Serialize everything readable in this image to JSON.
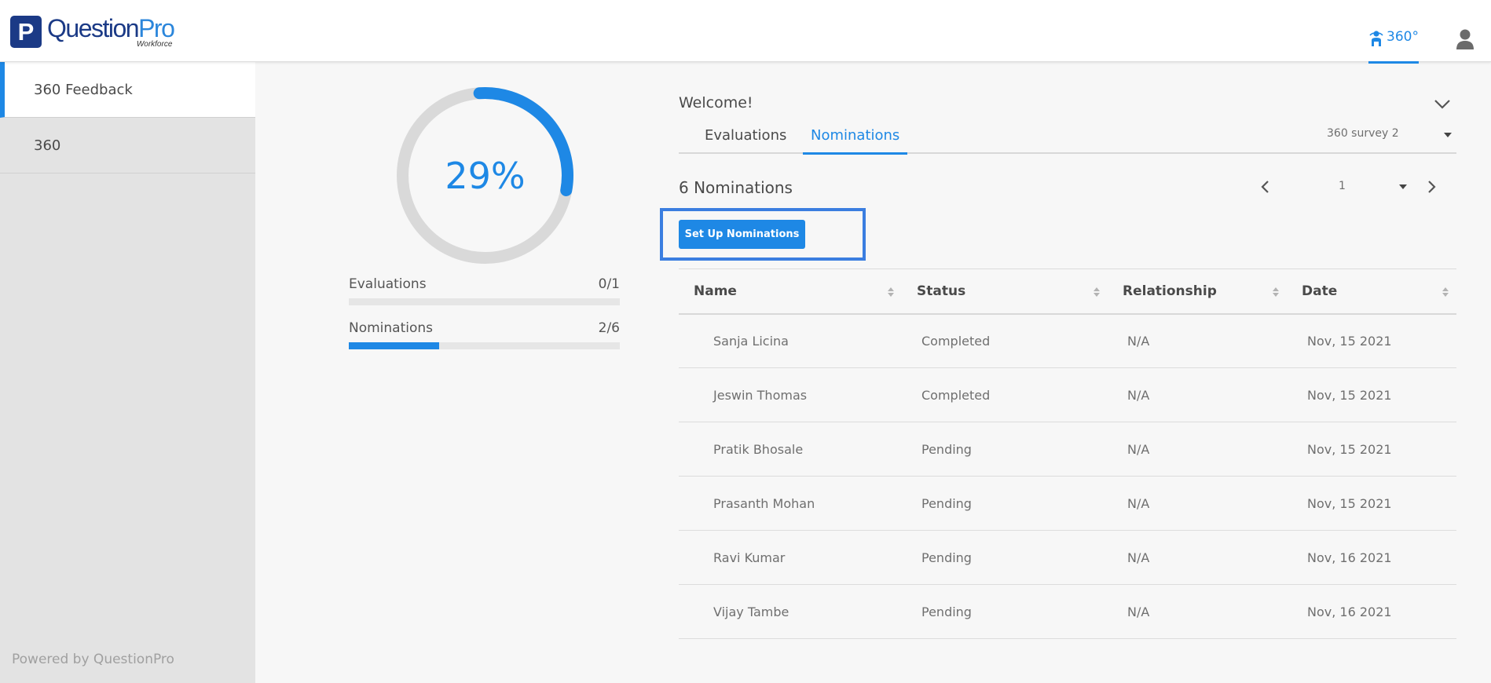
{
  "header": {
    "logo_mark": "P",
    "brand_question": "Question",
    "brand_pro": "Pro",
    "brand_sub": "Workforce",
    "mode_tab_label": "360°",
    "icons": {
      "mode": "person-360-icon",
      "user": "user-icon"
    }
  },
  "colors": {
    "accent": "#1e88e5",
    "brand_dark": "#1b3a86",
    "highlight_border": "#3b7ee0",
    "sidebar_bg": "#e3e3e3",
    "track": "#d9d9d9"
  },
  "sidebar": {
    "items": [
      {
        "label": "360 Feedback",
        "active": true
      },
      {
        "label": "360",
        "active": false
      }
    ],
    "footer": "Powered by QuestionPro"
  },
  "summary": {
    "completion_label": "29%",
    "completion_fraction": 0.29,
    "evaluations": {
      "label": "Evaluations",
      "value": "0/1",
      "fraction": 0.0
    },
    "nominations": {
      "label": "Nominations",
      "value": "2/6",
      "fraction": 0.333
    }
  },
  "panel": {
    "welcome": "Welcome!",
    "tabs": [
      {
        "label": "Evaluations",
        "active": false
      },
      {
        "label": "Nominations",
        "active": true
      }
    ],
    "survey_select": "360 survey 2",
    "count_title": "6 Nominations",
    "pager": {
      "page": "1"
    },
    "setup_button": "Set Up Nominations",
    "table": {
      "columns": [
        "Name",
        "Status",
        "Relationship",
        "Date"
      ],
      "rows": [
        [
          "Sanja Licina",
          "Completed",
          "N/A",
          "Nov, 15 2021"
        ],
        [
          "Jeswin Thomas",
          "Completed",
          "N/A",
          "Nov, 15 2021"
        ],
        [
          "Pratik Bhosale",
          "Pending",
          "N/A",
          "Nov, 15 2021"
        ],
        [
          "Prasanth Mohan",
          "Pending",
          "N/A",
          "Nov, 15 2021"
        ],
        [
          "Ravi Kumar",
          "Pending",
          "N/A",
          "Nov, 16 2021"
        ],
        [
          "Vijay Tambe",
          "Pending",
          "N/A",
          "Nov, 16 2021"
        ]
      ]
    }
  }
}
